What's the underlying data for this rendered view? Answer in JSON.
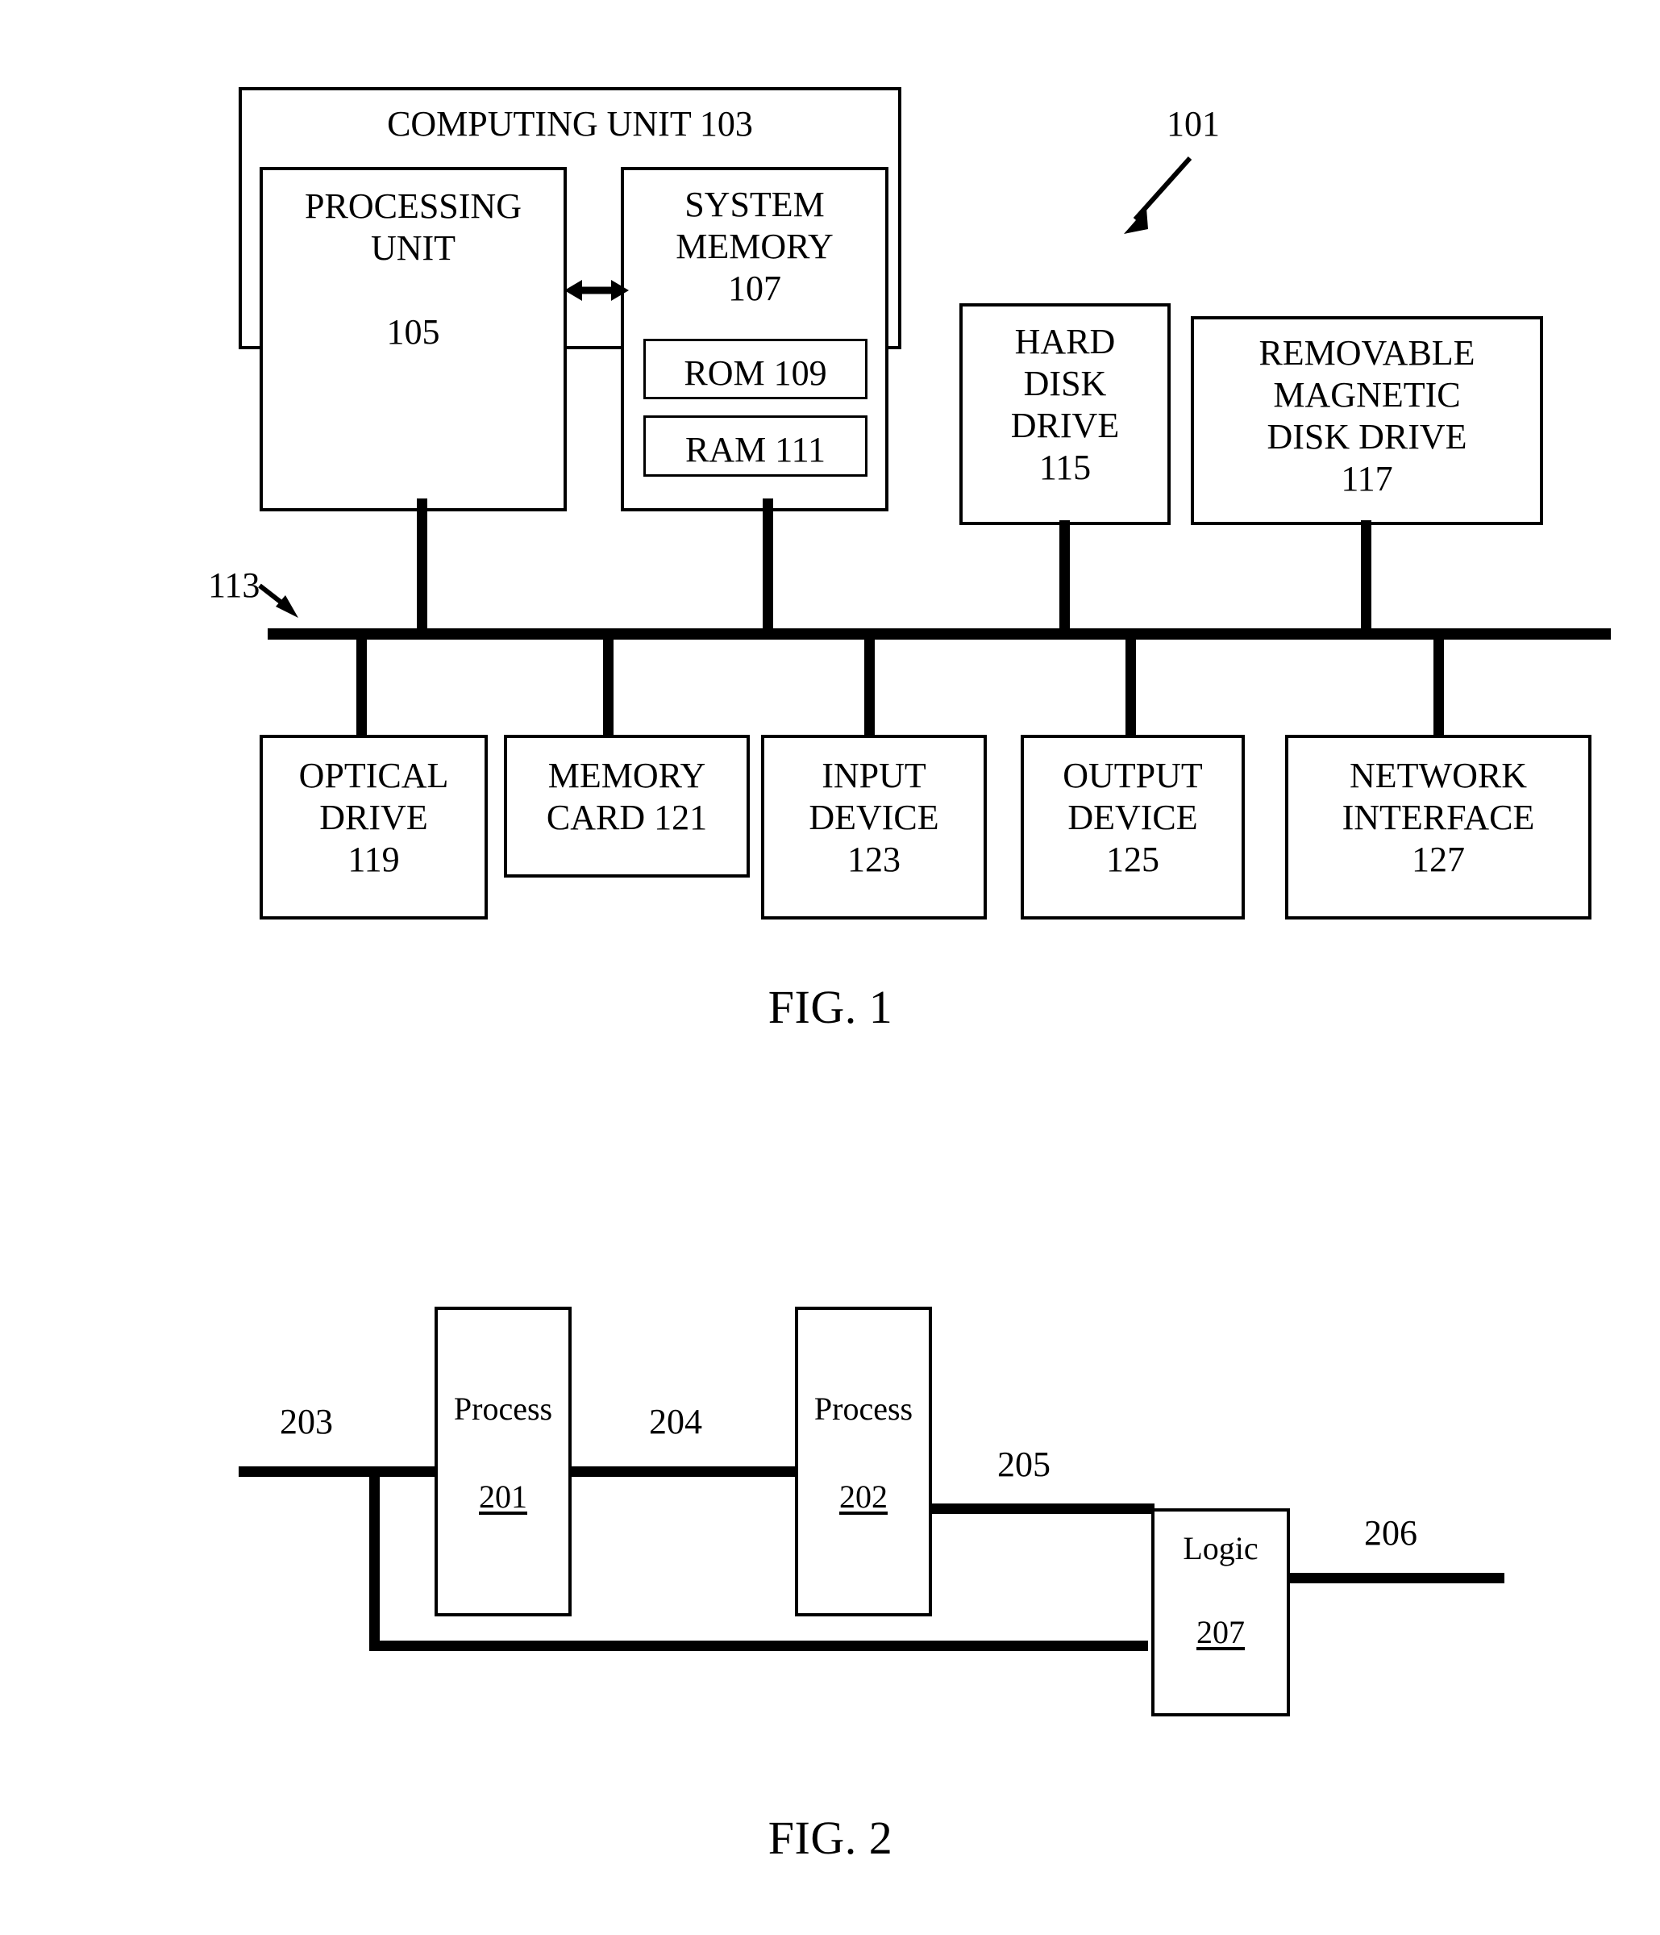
{
  "figure1": {
    "reference_numeral": "101",
    "bus_label": "113",
    "computing_unit": {
      "title": "COMPUTING UNIT 103",
      "processing_unit": "PROCESSING\nUNIT\n\n105",
      "system_memory": "SYSTEM\nMEMORY\n107",
      "rom": "ROM 109",
      "ram": "RAM 111"
    },
    "peripherals_top": [
      {
        "label": "HARD\nDISK\nDRIVE\n115"
      },
      {
        "label": "REMOVABLE\nMAGNETIC\nDISK DRIVE\n117"
      }
    ],
    "peripherals_bottom": [
      {
        "label": "OPTICAL\nDRIVE\n119"
      },
      {
        "label": "MEMORY\nCARD 121"
      },
      {
        "label": "INPUT\nDEVICE\n123"
      },
      {
        "label": "OUTPUT\nDEVICE\n125"
      },
      {
        "label": "NETWORK\nINTERFACE\n127"
      }
    ],
    "caption": "FIG. 1"
  },
  "figure2": {
    "blocks": [
      {
        "name": "Process",
        "numeral": "201"
      },
      {
        "name": "Process",
        "numeral": "202"
      },
      {
        "name": "Logic",
        "numeral": "207"
      }
    ],
    "signals": [
      {
        "label": "203"
      },
      {
        "label": "204"
      },
      {
        "label": "205"
      },
      {
        "label": "206"
      }
    ],
    "caption": "FIG. 2"
  }
}
